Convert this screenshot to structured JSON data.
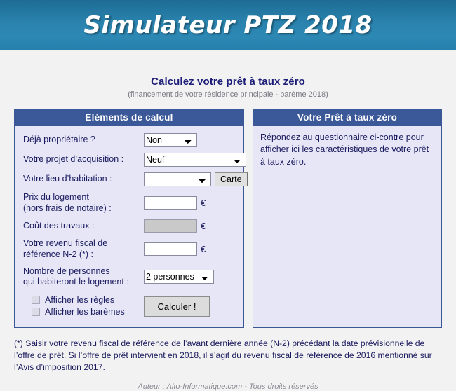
{
  "banner": {
    "title": "Simulateur PTZ 2018"
  },
  "intro": {
    "title": "Calculez votre prêt à taux zéro",
    "subtitle": "(financement de votre résidence principale - barème 2018)"
  },
  "left_panel": {
    "header": "Eléments de calcul",
    "fields": [
      {
        "label": "Déjà propriétaire ?",
        "type": "select",
        "value": "Non"
      },
      {
        "label": "Votre projet d’acquisition :",
        "type": "select",
        "value": "Neuf"
      },
      {
        "label": "Votre lieu d’habitation :",
        "type": "select",
        "value": "",
        "button_label": "Carte"
      },
      {
        "label": "Prix du logement\n(hors frais de notaire) :",
        "label_line1": "Prix du logement",
        "label_line2": "(hors frais de notaire) :",
        "type": "text",
        "value": "",
        "suffix": "€"
      },
      {
        "label": "Coût des travaux :",
        "type": "text",
        "value": "",
        "suffix": "€",
        "disabled": true
      },
      {
        "label_line1": "Votre revenu fiscal de",
        "label_line2": "référence N-2 (*) :",
        "type": "text",
        "value": "",
        "suffix": "€"
      },
      {
        "label_line1": "Nombre de personnes",
        "label_line2": "qui habiteront le logement :",
        "type": "select",
        "value": "2 personnes"
      }
    ],
    "checkboxes": [
      {
        "label": "Afficher les règles",
        "checked": false
      },
      {
        "label": "Afficher les barèmes",
        "checked": false
      }
    ],
    "submit_label": "Calculer !"
  },
  "right_panel": {
    "header": "Votre Prêt à taux zéro",
    "text": "Répondez au questionnaire ci-contre pour afficher ici les caractéristiques de votre prêt à taux zéro."
  },
  "footer": {
    "note": "(*) Saisir votre revenu fiscal de référence de l’avant dernière année (N-2) précédant la date prévisionnelle de l’offre de prêt. Si l’offre de prêt intervient en 2018, il s’agit du revenu fiscal de référence de 2016 mentionné sur l’Avis d’imposition 2017.",
    "author": "Auteur : Alto-Informatique.com - Tous droits réservés"
  },
  "colors": {
    "banner_top": "#1d6c94",
    "banner_mid": "#2d88b4",
    "panel_header": "#3b5998",
    "panel_bg": "#e6e6f7",
    "panel_border": "#3a5894",
    "text_navy": "#1a1a5e",
    "subtitle_gray": "#7b7b86"
  }
}
